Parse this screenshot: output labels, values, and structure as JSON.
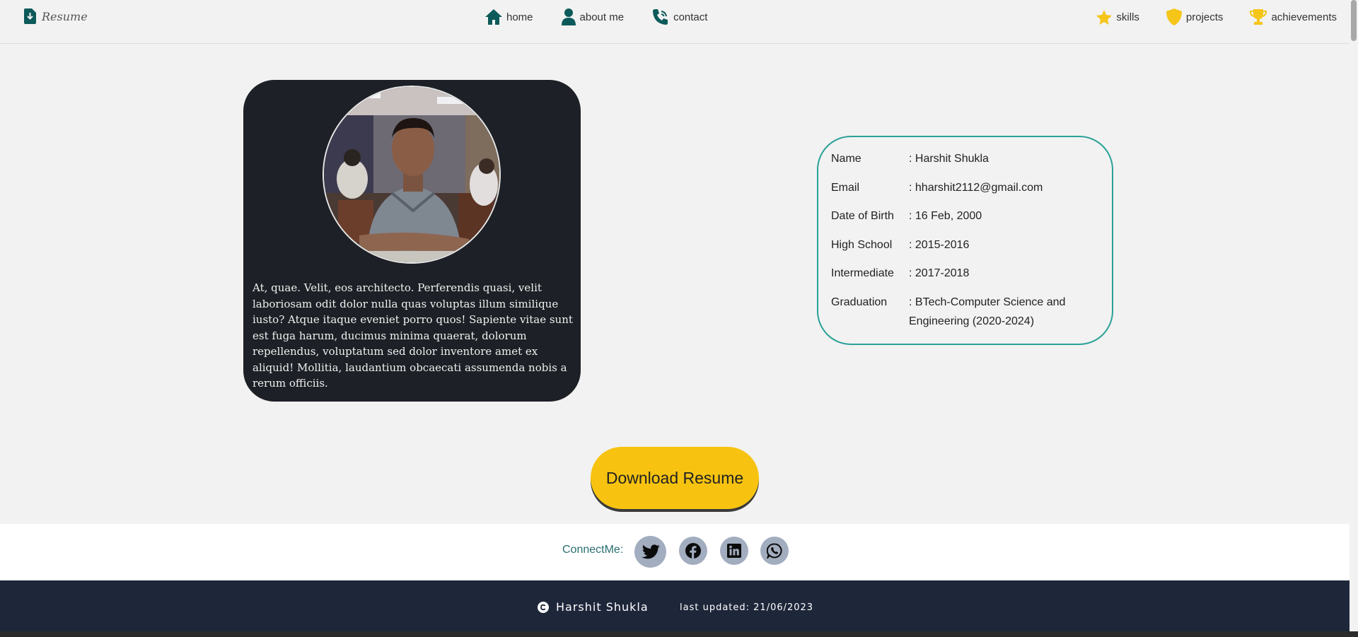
{
  "nav": {
    "brand": "Resume",
    "brand_icon": "file-download-icon",
    "center_links": [
      {
        "label": "home",
        "icon": "home-icon"
      },
      {
        "label": "about me",
        "icon": "user-icon"
      },
      {
        "label": "contact",
        "icon": "phone-icon"
      }
    ],
    "right_links": [
      {
        "label": "skills",
        "icon": "star-icon"
      },
      {
        "label": "projects",
        "icon": "shield-icon"
      },
      {
        "label": "achievements",
        "icon": "trophy-icon"
      }
    ]
  },
  "profile": {
    "bio": "At, quae. Velit, eos architecto. Perferendis quasi, velit laboriosam odit dolor nulla quas voluptas illum similique iusto? Atque itaque eveniet porro quos! Sapiente vitae sunt est fuga harum, ducimus minima quaerat, dolorum repellendus, voluptatum sed dolor inventore amet ex aliquid! Mollitia, laudantium obcaecati assumenda nobis a rerum officiis."
  },
  "info": {
    "rows": [
      {
        "label": "Name",
        "value": ": Harshit Shukla"
      },
      {
        "label": "Email",
        "value": ": hharshit2112@gmail.com"
      },
      {
        "label": "Date of Birth",
        "value": ": 16 Feb, 2000"
      },
      {
        "label": "High School",
        "value": ": 2015-2016"
      },
      {
        "label": "Intermediate",
        "value": ": 2017-2018"
      },
      {
        "label": "Graduation",
        "value": ": BTech-Computer Science and Engineering (2020-2024)"
      }
    ]
  },
  "download_label": "Download Resume",
  "connect": {
    "label": "ConnectMe:",
    "socials": [
      "twitter-icon",
      "facebook-icon",
      "linkedin-icon",
      "whatsapp-icon"
    ]
  },
  "footer": {
    "name": "Harshit Shukla",
    "updated": "last updated: 21/06/2023"
  },
  "colors": {
    "accent_teal": "#0d5a5a",
    "accent_gold": "#f5c518",
    "card_dark": "#1d2026",
    "info_border": "#2aa197",
    "button_yellow": "#f7c310",
    "footer_bg": "#1e273a",
    "social_bg": "#a2adbf"
  }
}
